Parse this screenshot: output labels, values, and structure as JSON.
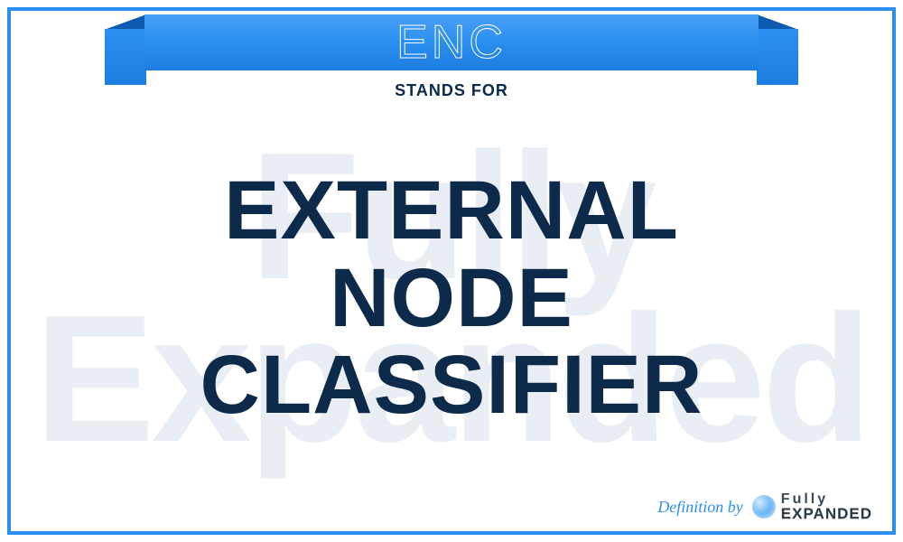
{
  "banner": {
    "acronym": "ENC",
    "stands_for": "STANDS FOR"
  },
  "definition": {
    "line1": "EXTERNAL",
    "line2": "NODE",
    "line3": "CLASSIFIER"
  },
  "watermark": {
    "line1": "Fully",
    "line2": "Expanded"
  },
  "footer": {
    "label": "Definition by",
    "brand_top": "Fully",
    "brand_bottom": "EXPANDED"
  }
}
